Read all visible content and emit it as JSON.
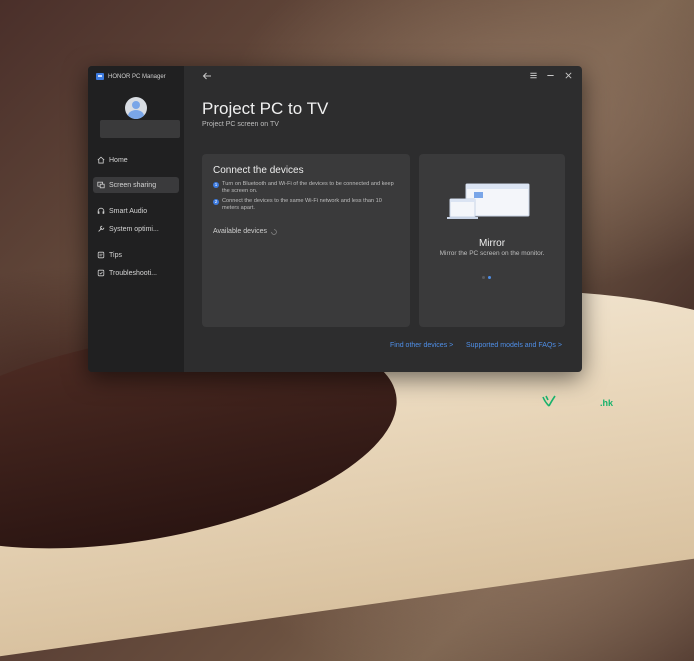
{
  "app": {
    "title": "HONOR PC Manager"
  },
  "sidebar": {
    "items": [
      {
        "label": "Home",
        "icon": "home-icon",
        "active": false
      },
      {
        "label": "Screen sharing",
        "icon": "screen-share-icon",
        "active": true
      },
      {
        "label": "Smart Audio",
        "icon": "headphones-icon",
        "active": false
      },
      {
        "label": "System optimi...",
        "icon": "wrench-icon",
        "active": false
      },
      {
        "label": "Tips",
        "icon": "tips-icon",
        "active": false
      },
      {
        "label": "Troubleshooti...",
        "icon": "troubleshoot-icon",
        "active": false
      }
    ]
  },
  "page": {
    "title": "Project PC to TV",
    "subtitle": "Project PC screen on TV"
  },
  "connect_card": {
    "heading": "Connect the devices",
    "steps": [
      {
        "num": "1",
        "text": "Turn on Bluetooth and Wi-Fi of the devices to be connected and keep the screen on."
      },
      {
        "num": "2",
        "text": "Connect the devices to the same Wi-Fi network and less than 10 meters apart."
      }
    ],
    "available_label": "Available devices"
  },
  "mirror_card": {
    "title": "Mirror",
    "description": "Mirror the PC screen on the monitor."
  },
  "footer": {
    "find_other": "Find other devices >",
    "supported": "Supported models and FAQs >"
  },
  "watermark": {
    "text": ".hk"
  },
  "colors": {
    "accent": "#3d7be0",
    "link": "#4f8fe8",
    "window_bg": "#2d2d2e",
    "sidebar_bg": "#202021",
    "watermark": "#17b26b"
  }
}
